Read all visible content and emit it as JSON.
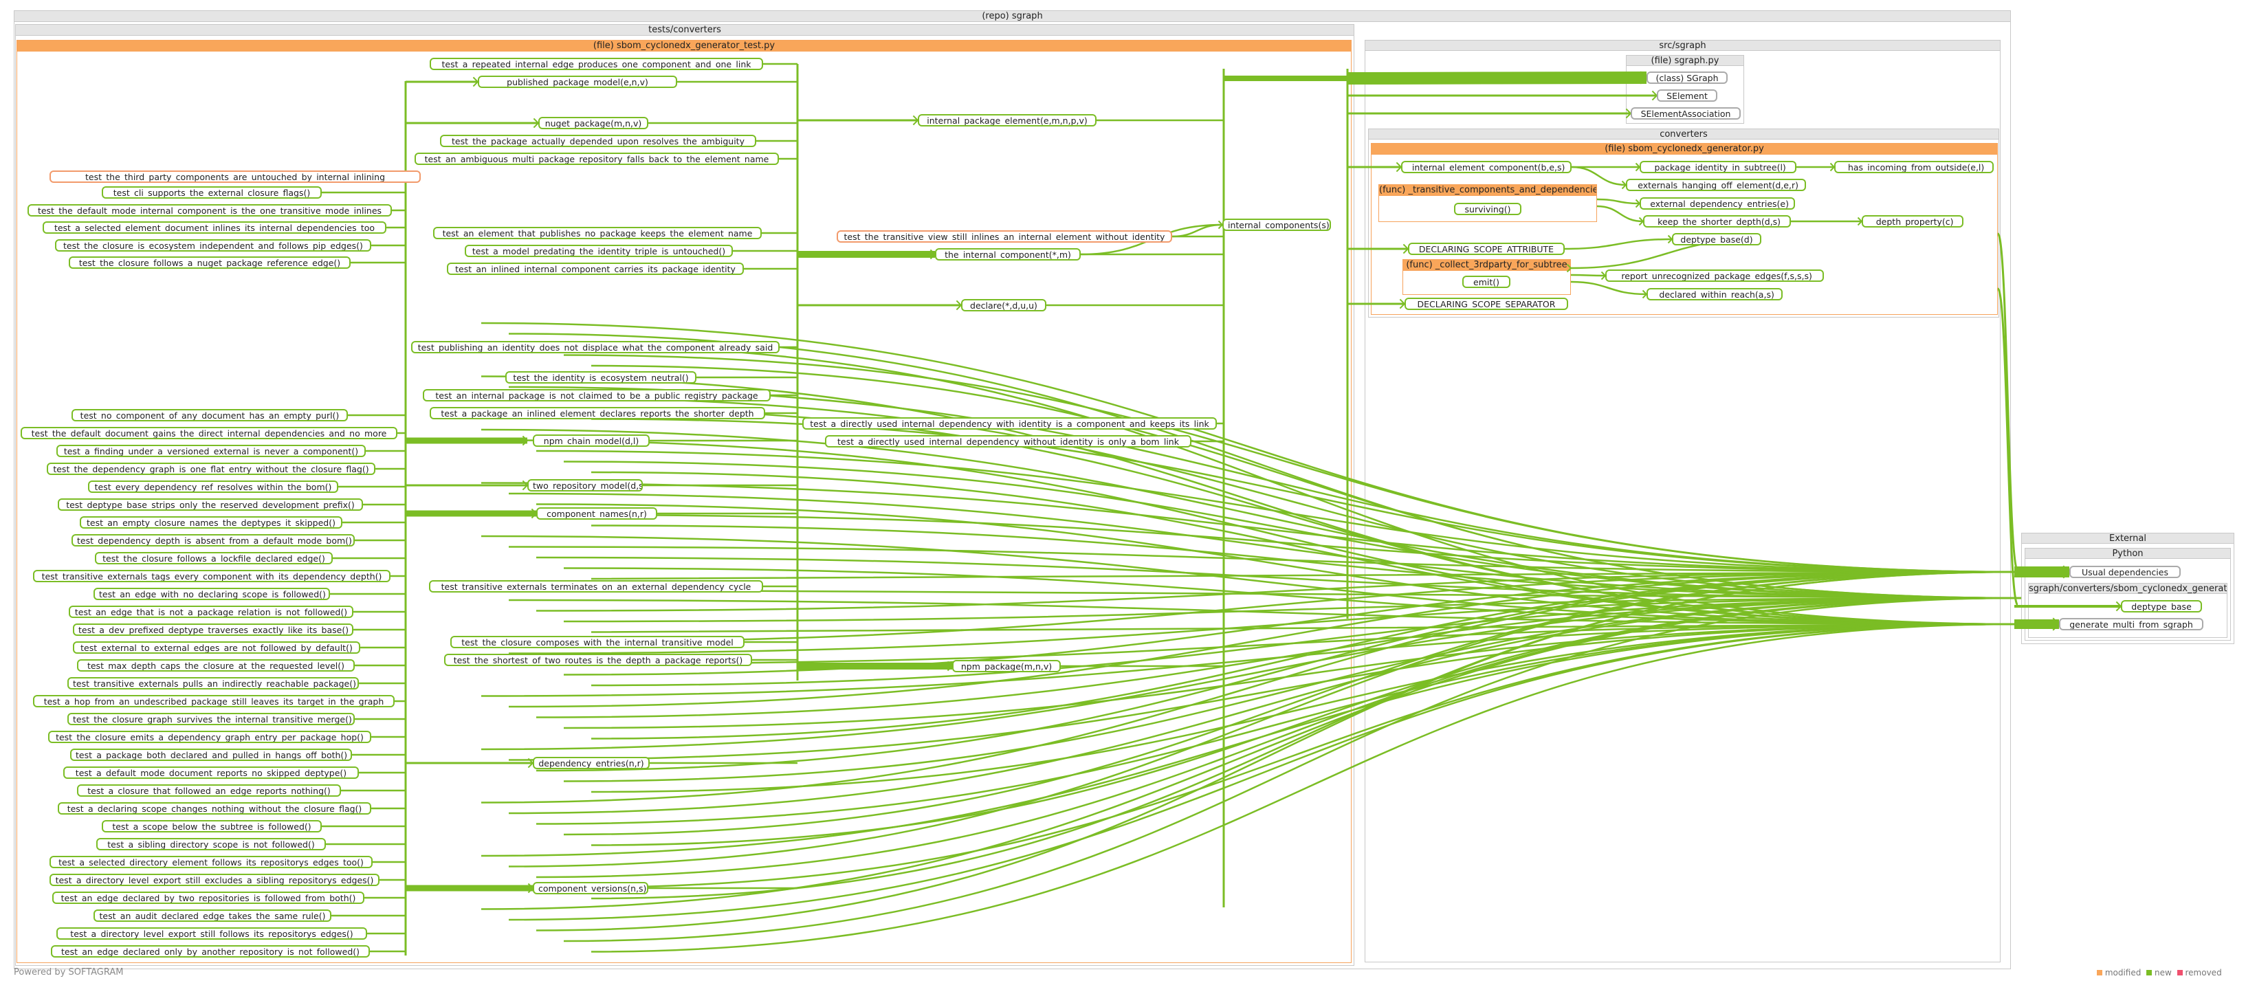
{
  "frames": {
    "repo": "(repo) sgraph",
    "tests_converters": "tests/converters",
    "test_file": "(file) sbom_cyclonedx_generator_test.py",
    "src_sgraph": "src/sgraph",
    "sgraph_py": "(file) sgraph.py",
    "converters": "converters",
    "gen_file": "(file) sbom_cyclonedx_generator.py",
    "func_transitive": "(func) _transitive_components_and_dependencies",
    "func_collect": "(func) _collect_3rdparty_for_subtree",
    "external": "External",
    "python": "Python",
    "ext_module": "sgraph/converters/sbom_cyclonedx_generator"
  },
  "tests_left": [
    "test_the_third_party_components_are_untouched_by_internal_inlining",
    "test_cli_supports_the_external_closure_flags()",
    "test_the_default_mode_internal_component_is_the_one_transitive_mode_inlines",
    "test_a_selected_element_document_inlines_its_internal_dependencies_too",
    "test_the_closure_is_ecosystem_independent_and_follows_pip_edges()",
    "test_the_closure_follows_a_nuget_package_reference_edge()",
    "test_no_component_of_any_document_has_an_empty_purl()",
    "test_the_default_document_gains_the_direct_internal_dependencies_and_no_more",
    "test_a_finding_under_a_versioned_external_is_never_a_component()",
    "test_the_dependency_graph_is_one_flat_entry_without_the_closure_flag()",
    "test_every_dependency_ref_resolves_within_the_bom()",
    "test_deptype_base_strips_only_the_reserved_development_prefix()",
    "test_an_empty_closure_names_the_deptypes_it_skipped()",
    "test_dependency_depth_is_absent_from_a_default_mode_bom()",
    "test_the_closure_follows_a_lockfile_declared_edge()",
    "test_transitive_externals_tags_every_component_with_its_dependency_depth()",
    "test_an_edge_with_no_declaring_scope_is_followed()",
    "test_an_edge_that_is_not_a_package_relation_is_not_followed()",
    "test_a_dev_prefixed_deptype_traverses_exactly_like_its_base()",
    "test_external_to_external_edges_are_not_followed_by_default()",
    "test_max_depth_caps_the_closure_at_the_requested_level()",
    "test_transitive_externals_pulls_an_indirectly_reachable_package()",
    "test_a_hop_from_an_undescribed_package_still_leaves_its_target_in_the_graph",
    "test_the_closure_graph_survives_the_internal_transitive_merge()",
    "test_the_closure_emits_a_dependency_graph_entry_per_package_hop()",
    "test_a_package_both_declared_and_pulled_in_hangs_off_both()",
    "test_a_default_mode_document_reports_no_skipped_deptype()",
    "test_a_closure_that_followed_an_edge_reports_nothing()",
    "test_a_declaring_scope_changes_nothing_without_the_closure_flag()",
    "test_a_scope_below_the_subtree_is_followed()",
    "test_a_sibling_directory_scope_is_not_followed()",
    "test_a_selected_directory_element_follows_its_repositorys_edges_too()",
    "test_a_directory_level_export_still_excludes_a_sibling_repositorys_edges()",
    "test_an_edge_declared_by_two_repositories_is_followed_from_both()",
    "test_an_audit_declared_edge_takes_the_same_rule()",
    "test_a_directory_level_export_still_follows_its_repositorys_edges()",
    "test_an_edge_declared_only_by_another_repository_is_not_followed()"
  ],
  "tests_mid": [
    "test_a_repeated_internal_edge_produces_one_component_and_one_link",
    "published_package_model(e,n,v)",
    "nuget_package(m,n,v)",
    "test_the_package_actually_depended_upon_resolves_the_ambiguity",
    "test_an_ambiguous_multi_package_repository_falls_back_to_the_element_name",
    "test_an_element_that_publishes_no_package_keeps_the_element_name",
    "test_a_model_predating_the_identity_triple_is_untouched()",
    "test_an_inlined_internal_component_carries_its_package_identity",
    "test_publishing_an_identity_does_not_displace_what_the_component_already_said",
    "test_the_identity_is_ecosystem_neutral()",
    "test_an_internal_package_is_not_claimed_to_be_a_public_registry_package",
    "test_a_package_an_inlined_element_declares_reports_the_shorter_depth",
    "npm_chain_model(d,l)",
    "two_repository_model(d,s,s)",
    "component_names(n,r)",
    "test_transitive_externals_terminates_on_an_external_dependency_cycle",
    "test_the_closure_composes_with_the_internal_transitive_model",
    "test_the_shortest_of_two_routes_is_the_depth_a_package_reports()",
    "dependency_entries(n,r)",
    "component_versions(n,s)"
  ],
  "tests_right": [
    "internal_package_element(e,m,n,p,v)",
    "test_the_transitive_view_still_inlines_an_internal_element_without_identity",
    "the_internal_component(*,m)",
    "internal_components(s)",
    "declare(*,d,u,u)",
    "test_a_directly_used_internal_dependency_with_identity_is_a_component_and_keeps_its_link",
    "test_a_directly_used_internal_dependency_without_identity_is_only_a_bom_link",
    "npm_package(m,n,v)"
  ],
  "sgraph_classes": [
    "(class) SGraph",
    "SElement",
    "SElementAssociation"
  ],
  "gen_nodes": {
    "internal_element_component": "_internal_element_component(b,e,s)",
    "package_identity": "_package_identity_in_subtree(l)",
    "has_incoming": "_has_incoming_from_outside(e,l)",
    "externals_hanging": "_externals_hanging_off_element(d,e,r)",
    "surviving": "surviving()",
    "external_dependency_entries": "_external_dependency_entries(e)",
    "keep_shorter": "_keep_the_shorter_depth(d,s)",
    "depth_property": "_depth_property(c)",
    "deptype_base": "deptype_base(d)",
    "declaring_scope_attribute": "DECLARING_SCOPE_ATTRIBUTE",
    "emit": "emit()",
    "report_unrecognized": "_report_unrecognized_package_edges(f,s,s,s)",
    "declared_within_reach": "_declared_within_reach(a,s)",
    "declaring_scope_separator": "DECLARING_SCOPE_SEPARATOR"
  },
  "external_nodes": {
    "usual": "Usual dependencies",
    "deptype_base": "deptype_base",
    "generate": "generate_multi_from_sgraph"
  },
  "legend": {
    "modified": "modified",
    "new": "new",
    "removed": "removed"
  },
  "colors": {
    "modified": "#f9a65a",
    "new": "#7bbd25",
    "removed": "#f0506e",
    "edge": "#7bbd25"
  },
  "footer": "Powered by SOFTAGRAM"
}
